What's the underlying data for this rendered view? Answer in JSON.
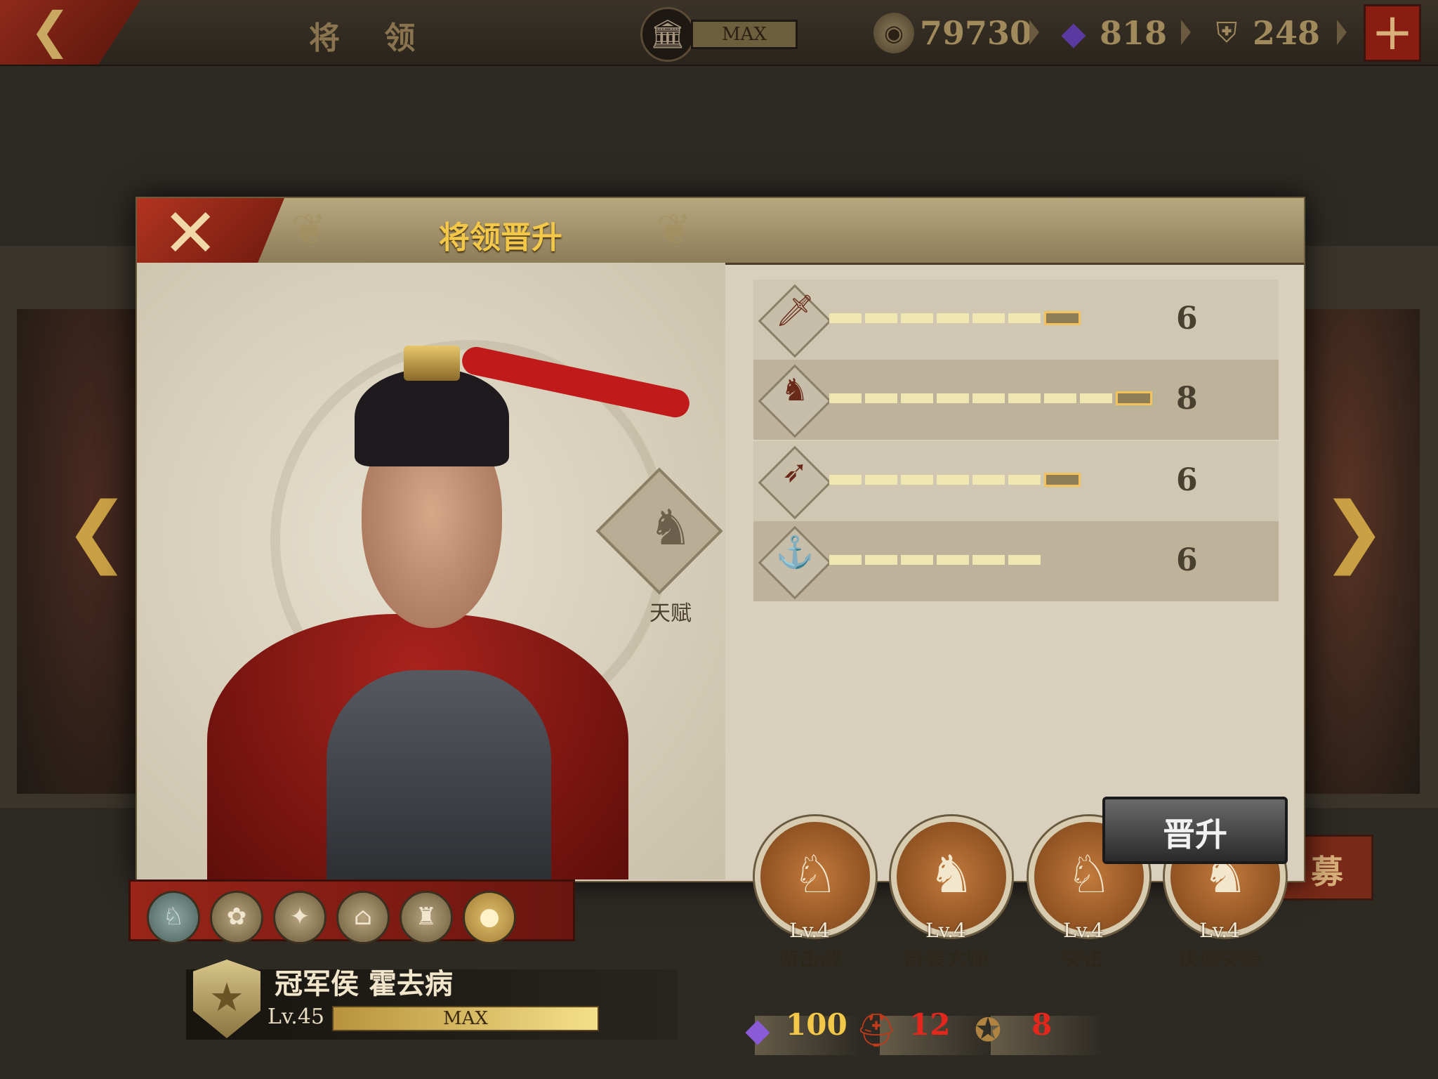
{
  "header": {
    "title": "将 领",
    "museum_max": "MAX",
    "resources": [
      {
        "icon": "coin-icon",
        "value": "79730"
      },
      {
        "icon": "gem-icon",
        "value": "818"
      },
      {
        "icon": "helmet-coin-icon",
        "value": "248"
      }
    ],
    "plus_label": "+"
  },
  "background": {
    "recruit_label": "募"
  },
  "modal": {
    "title": "将领晋升",
    "close_label": "✕",
    "talent_label": "天赋",
    "hero": {
      "name": "冠军侯 霍去病",
      "level": "Lv.45",
      "level_bar": "MAX",
      "level_fill": 1.0
    },
    "skill_icons": [
      "shield-horse-icon",
      "wolf-icon",
      "compass-icon",
      "gate-icon",
      "castle-icon",
      "lock-icon"
    ],
    "stats": [
      {
        "icon": "sword-icon",
        "value": "6",
        "filled": 6,
        "total": 7
      },
      {
        "icon": "horse-icon",
        "value": "8",
        "filled": 8,
        "total": 9
      },
      {
        "icon": "bow-icon",
        "value": "6",
        "filled": 6,
        "total": 7
      },
      {
        "icon": "anchor-icon",
        "value": "6",
        "filled": 6,
        "total": 6
      }
    ],
    "skills": [
      {
        "level": "Lv.4",
        "name": "游击战"
      },
      {
        "level": "Lv.4",
        "name": "奇袭大师"
      },
      {
        "level": "Lv.4",
        "name": "突击"
      },
      {
        "level": "Lv.4",
        "name": "快速突袭"
      }
    ],
    "costs": [
      {
        "icon": "gem-icon",
        "value": "100",
        "color": "#f3c849"
      },
      {
        "icon": "spartan-helmet-icon",
        "value": "12",
        "color": "#e3271c"
      },
      {
        "icon": "medal-icon",
        "value": "8",
        "color": "#e3271c"
      }
    ],
    "promote_label": "晋升"
  }
}
